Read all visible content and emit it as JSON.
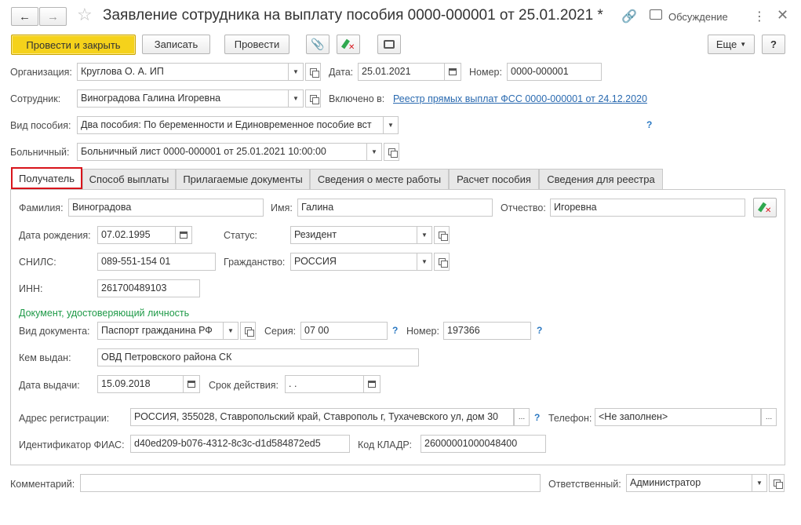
{
  "window": {
    "title": "Заявление сотрудника на выплату пособия 0000-000001 от 25.01.2021 *",
    "discussion_label": "Обсуждение"
  },
  "toolbar": {
    "post_close_label": "Провести и закрыть",
    "write_label": "Записать",
    "post_label": "Провести",
    "more_label": "Еще",
    "help_label": "?"
  },
  "header": {
    "org_label": "Организация:",
    "org_value": "Круглова О. А. ИП",
    "date_label": "Дата:",
    "date_value": "25.01.2021",
    "number_label": "Номер:",
    "number_value": "0000-000001",
    "employee_label": "Сотрудник:",
    "employee_value": "Виноградова Галина Игоревна",
    "included_label": "Включено в:",
    "included_link": "Реестр прямых выплат ФСС 0000-000001 от 24.12.2020",
    "benefit_label": "Вид пособия:",
    "benefit_value": "Два пособия: По беременности и Единовременное пособие вст",
    "sick_label": "Больничный:",
    "sick_value": "Больничный лист 0000-000001 от 25.01.2021 10:00:00",
    "help_q": "?"
  },
  "tabs": [
    {
      "label": "Получатель"
    },
    {
      "label": "Способ выплаты"
    },
    {
      "label": "Прилагаемые документы"
    },
    {
      "label": "Сведения о месте работы"
    },
    {
      "label": "Расчет пособия"
    },
    {
      "label": "Сведения для реестра"
    }
  ],
  "recipient": {
    "surname_label": "Фамилия:",
    "surname_value": "Виноградова",
    "name_label": "Имя:",
    "name_value": "Галина",
    "patronymic_label": "Отчество:",
    "patronymic_value": "Игоревна",
    "birth_label": "Дата рождения:",
    "birth_value": "07.02.1995",
    "status_label": "Статус:",
    "status_value": "Резидент",
    "snils_label": "СНИЛС:",
    "snils_value": "089-551-154 01",
    "citizenship_label": "Гражданство:",
    "citizenship_value": "РОССИЯ",
    "inn_label": "ИНН:",
    "inn_value": "261700489103",
    "doc_section": "Документ, удостоверяющий личность",
    "doc_type_label": "Вид документа:",
    "doc_type_value": "Паспорт гражданина РФ",
    "series_label": "Серия:",
    "series_value": "07 00",
    "doc_number_label": "Номер:",
    "doc_number_value": "197366",
    "issued_by_label": "Кем выдан:",
    "issued_by_value": "ОВД Петровского района СК",
    "issue_date_label": "Дата выдачи:",
    "issue_date_value": "15.09.2018",
    "validity_label": "Срок действия:",
    "validity_value": " .  .",
    "address_label": "Адрес регистрации:",
    "address_value": "РОССИЯ, 355028, Ставропольский край, Ставрополь г, Тухачевского ул, дом 30",
    "phone_label": "Телефон:",
    "phone_value": "<Не заполнен>",
    "fias_label": "Идентификатор ФИАС:",
    "fias_value": "d40ed209-b076-4312-8c3c-d1d584872ed5",
    "kladr_label": "Код КЛАДР:",
    "kladr_value": "26000001000048400",
    "ellipsis": "...",
    "help_q": "?"
  },
  "footer": {
    "comment_label": "Комментарий:",
    "comment_value": "",
    "responsible_label": "Ответственный:",
    "responsible_value": "Администратор"
  },
  "colors": {
    "accent": "#f5d21b",
    "link": "#2a6ab0",
    "section_green": "#1f9a48",
    "active_tab_border": "#d8141b"
  }
}
